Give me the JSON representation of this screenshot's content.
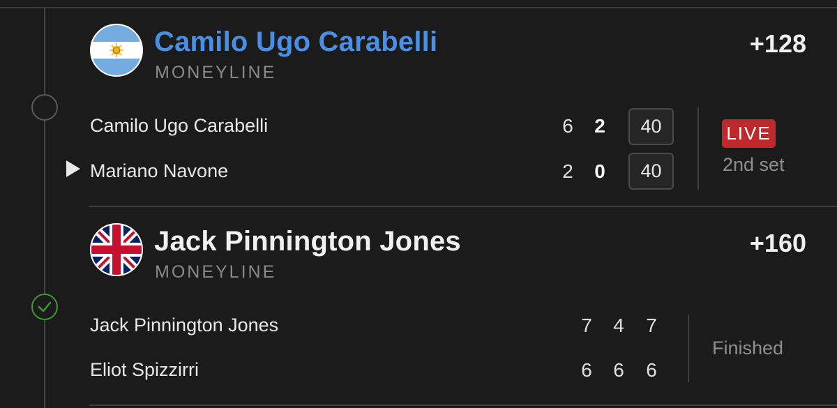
{
  "bets": [
    {
      "pick": "Camilo Ugo Carabelli",
      "market": "MONEYLINE",
      "odds": "+128",
      "flag_icon": "argentina-flag-icon",
      "pick_color": "#4a8fe6",
      "match": {
        "players": [
          {
            "name": "Camilo Ugo Carabelli",
            "sets": [
              "6",
              "2"
            ],
            "game_points": "40",
            "serving": false
          },
          {
            "name": "Mariano Navone",
            "sets": [
              "2",
              "0"
            ],
            "game_points": "40",
            "serving": true
          }
        ],
        "status_badge": "LIVE",
        "status_badge_color": "#c0292b",
        "status_text": "2nd set"
      }
    },
    {
      "pick": "Jack Pinnington Jones",
      "market": "MONEYLINE",
      "odds": "+160",
      "flag_icon": "united-kingdom-flag-icon",
      "pick_color": "#f0f0f0",
      "result": "won",
      "result_color": "#3f9a2e",
      "match": {
        "players": [
          {
            "name": "Jack Pinnington Jones",
            "sets": [
              "7",
              "4",
              "7"
            ]
          },
          {
            "name": "Eliot Spizzirri",
            "sets": [
              "6",
              "6",
              "6"
            ]
          }
        ],
        "status_text": "Finished"
      }
    }
  ]
}
